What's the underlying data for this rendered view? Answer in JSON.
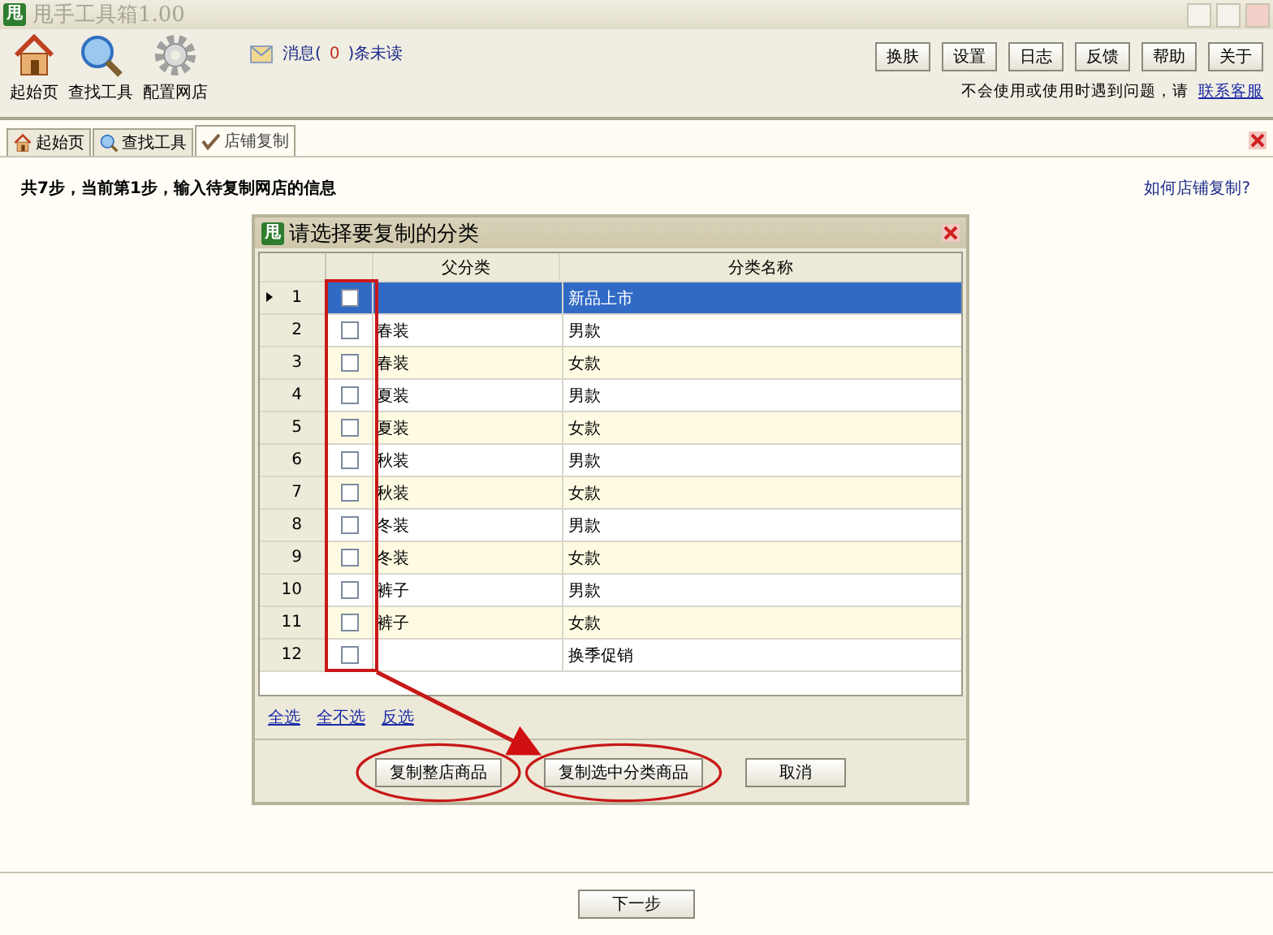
{
  "window": {
    "title": "甩手工具箱1.00",
    "logo": "甩"
  },
  "toolbar": {
    "tools": [
      {
        "kind": "home",
        "label": "起始页"
      },
      {
        "kind": "search",
        "label": "查找工具"
      },
      {
        "kind": "gear",
        "label": "配置网店"
      }
    ],
    "messages": {
      "prefix": "消息(",
      "count": "0",
      "suffix": ")条未读"
    },
    "buttons": [
      "换肤",
      "设置",
      "日志",
      "反馈",
      "帮助",
      "关于"
    ],
    "help_text": "不会使用或使用时遇到问题，请",
    "help_link": "联系客服"
  },
  "tabs": [
    {
      "kind": "home",
      "label": "起始页",
      "selected": false
    },
    {
      "kind": "search",
      "label": "查找工具",
      "selected": false
    },
    {
      "kind": "check",
      "label": "店铺复制",
      "selected": true
    }
  ],
  "step_text": "共7步，当前第1步，输入待复制网店的信息",
  "howto_link": "如何店铺复制?",
  "dialog": {
    "logo": "甩",
    "title": "请选择要复制的分类",
    "columns": [
      "父分类",
      "分类名称"
    ],
    "rows": [
      {
        "number": "1",
        "checked": false,
        "name": "新品上市",
        "selected": true
      },
      {
        "number": "2",
        "checked": false,
        "parent": "春装",
        "name": "男款",
        "selected": false
      },
      {
        "number": "3",
        "checked": false,
        "parent": "春装",
        "name": "女款",
        "selected": false
      },
      {
        "number": "4",
        "checked": false,
        "parent": "夏装",
        "name": "男款",
        "selected": false
      },
      {
        "number": "5",
        "checked": false,
        "parent": "夏装",
        "name": "女款",
        "selected": false
      },
      {
        "number": "6",
        "checked": false,
        "parent": "秋装",
        "name": "男款",
        "selected": false
      },
      {
        "number": "7",
        "checked": false,
        "parent": "秋装",
        "name": "女款",
        "selected": false
      },
      {
        "number": "8",
        "checked": false,
        "parent": "冬装",
        "name": "男款",
        "selected": false
      },
      {
        "number": "9",
        "checked": false,
        "parent": "冬装",
        "name": "女款",
        "selected": false
      },
      {
        "number": "10",
        "checked": false,
        "parent": "裤子",
        "name": "男款",
        "selected": false
      },
      {
        "number": "11",
        "checked": false,
        "parent": "裤子",
        "name": "女款",
        "selected": false
      },
      {
        "number": "12",
        "checked": false,
        "name": "换季促销",
        "selected": false
      }
    ],
    "links": [
      "全选",
      "全不选",
      "反选"
    ],
    "buttons": [
      {
        "label": "复制整店商品",
        "circled": true
      },
      {
        "label": "复制选中分类商品",
        "circled": true,
        "arrow_target": true
      },
      {
        "label": "取消",
        "circled": false
      }
    ]
  },
  "next_button": "下一步"
}
